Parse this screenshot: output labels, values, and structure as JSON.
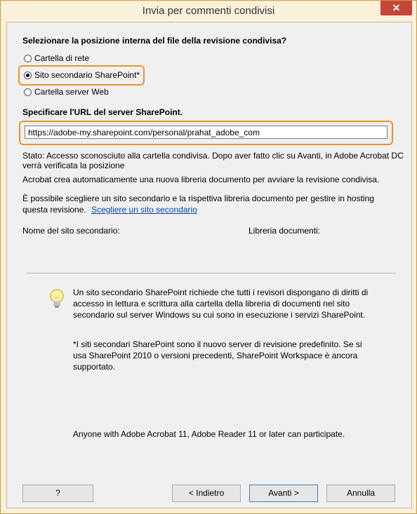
{
  "window": {
    "title": "Invia per commenti condivisi",
    "close_glyph": "✕"
  },
  "location": {
    "heading": "Selezionare la posizione interna del file della revisione condivisa?",
    "options": [
      "Cartella di rete",
      "Sito secondario SharePoint*",
      "Cartella server Web"
    ],
    "selected_index": 1
  },
  "url": {
    "heading": "Specificare l'URL del server SharePoint.",
    "value": "https://adobe-my.sharepoint.com/personal/prahat_adobe_com"
  },
  "status": {
    "line1": "Stato: Accesso sconosciuto alla cartella condivisa. Dopo aver fatto clic su Avanti, in Adobe Acrobat DC",
    "line2": "verrà verificata la posizione"
  },
  "info": {
    "library": "Acrobat crea automaticamente una nuova libreria documento per avviare la revisione condivisa.",
    "subsite_line1": "È possibile scegliere un sito secondario e la rispettiva libreria documento per gestire in hosting",
    "subsite_line2": "questa revisione.",
    "choose_link": "Scegliere un sito secondario",
    "subsite_name_label": "Nome del sito secondario:",
    "doc_library_label": "Libreria documenti:"
  },
  "tip": {
    "icon": "lightbulb-icon",
    "p1_line1": "Un sito secondario SharePoint richiede che tutti i revisori dispongano di diritti di",
    "p1_line2": "accesso in lettura e scrittura alla cartella della libreria di documenti nel sito",
    "p1_line3": "secondario sul server Windows su cui sono in esecuzione i servizi SharePoint.",
    "p2_line1": "*I siti secondari SharePoint sono il nuovo server di revisione predefinito. Se si",
    "p2_line2": "usa SharePoint 2010 o versioni precedenti, SharePoint Workspace è ancora",
    "p2_line3": "supportato.",
    "compat": "Anyone with Adobe Acrobat 11, Adobe Reader 11 or later can participate."
  },
  "buttons": {
    "help": "?",
    "back": "< Indietro",
    "next": "Avanti >",
    "cancel": "Annulla"
  },
  "colors": {
    "highlight": "#e8942a",
    "titlebar": "#fbf0da",
    "close": "#c7463a",
    "link": "#0645ad"
  }
}
